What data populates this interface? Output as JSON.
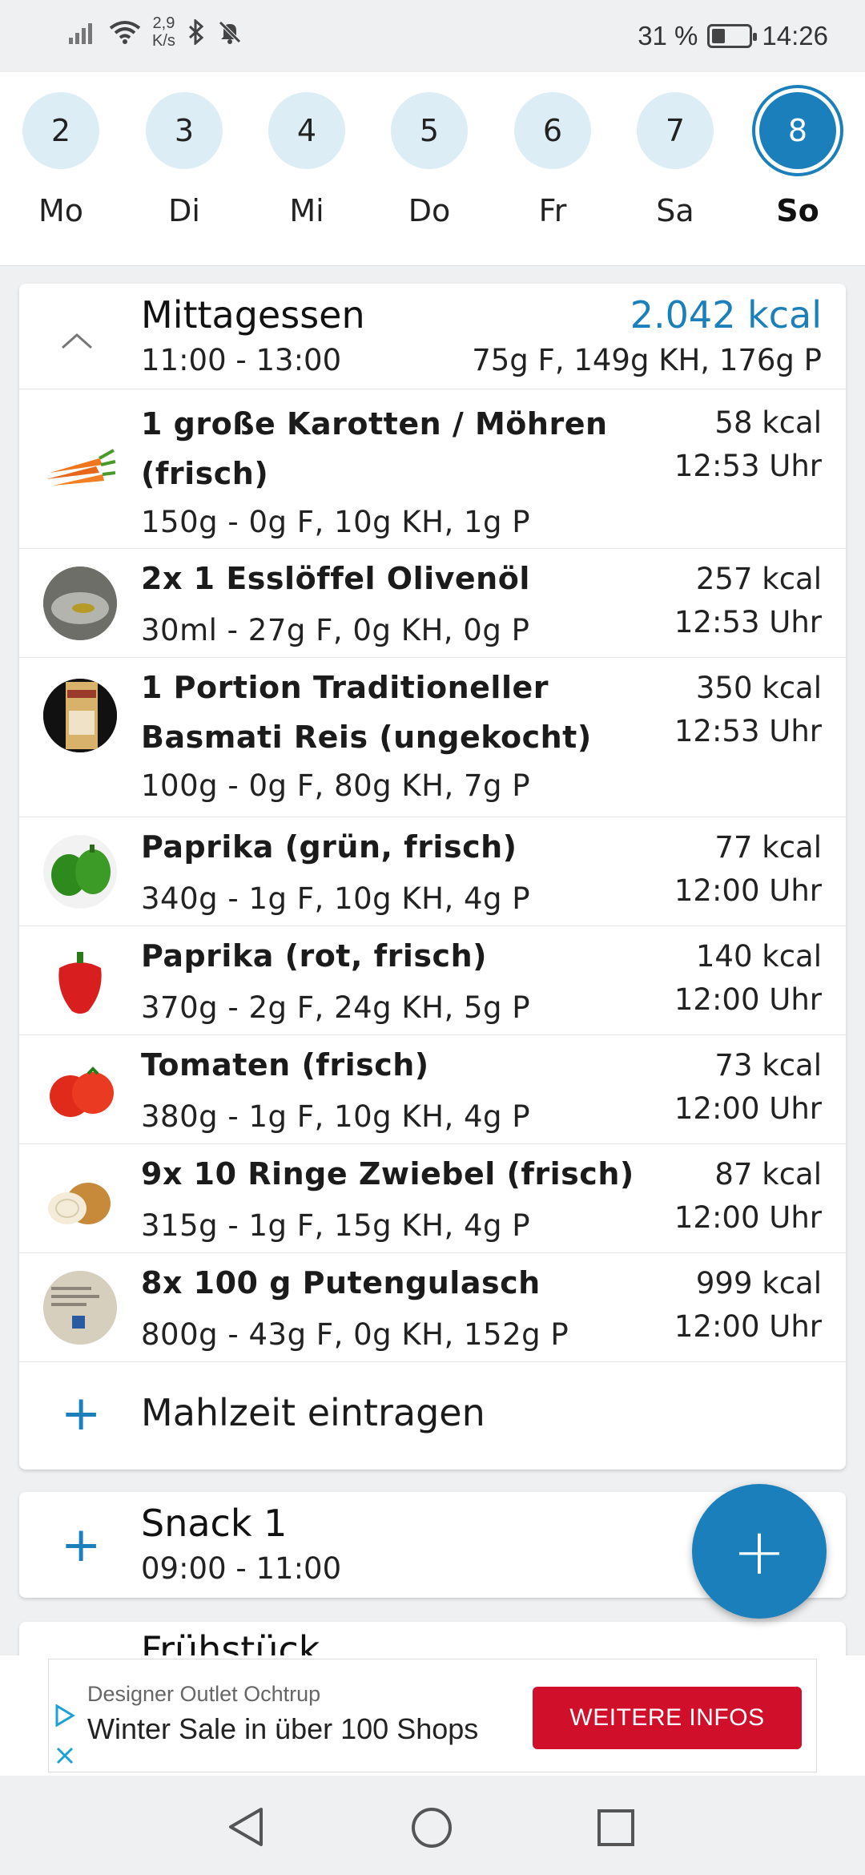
{
  "status": {
    "net_speed_value": "2,9",
    "net_speed_unit": "K/s",
    "battery": "31 %",
    "time": "14:26"
  },
  "week": {
    "days": [
      {
        "num": "2",
        "label": "Mo"
      },
      {
        "num": "3",
        "label": "Di"
      },
      {
        "num": "4",
        "label": "Mi"
      },
      {
        "num": "5",
        "label": "Do"
      },
      {
        "num": "6",
        "label": "Fr"
      },
      {
        "num": "7",
        "label": "Sa"
      },
      {
        "num": "8",
        "label": "So"
      }
    ],
    "selected_index": 6
  },
  "lunch": {
    "title": "Mittagessen",
    "time": "11:00 - 13:00",
    "kcal": "2.042 kcal",
    "macros": "75g F, 149g KH, 176g P",
    "items": [
      {
        "name_line1": "1 große Karotten / Möhren",
        "name_line2": "(frisch)",
        "details": "150g - 0g F, 10g KH, 1g P",
        "kcal": "58 kcal",
        "time": "12:53 Uhr",
        "image": "carrot"
      },
      {
        "name_line1": "2x 1 Esslöffel Olivenöl",
        "name_line2": "",
        "details": "30ml - 27g F, 0g KH, 0g P",
        "kcal": "257 kcal",
        "time": "12:53 Uhr",
        "image": "olive-oil"
      },
      {
        "name_line1": "1 Portion Traditioneller",
        "name_line2": "Basmati Reis (ungekocht)",
        "details": "100g - 0g F, 80g KH, 7g P",
        "kcal": "350 kcal",
        "time": "12:53 Uhr",
        "image": "basmati-rice"
      },
      {
        "name_line1": "Paprika (grün, frisch)",
        "name_line2": "",
        "details": "340g - 1g F, 10g KH, 4g P",
        "kcal": "77 kcal",
        "time": "12:00 Uhr",
        "image": "green-pepper"
      },
      {
        "name_line1": "Paprika (rot, frisch)",
        "name_line2": "",
        "details": "370g - 2g F, 24g KH, 5g P",
        "kcal": "140 kcal",
        "time": "12:00 Uhr",
        "image": "red-pepper"
      },
      {
        "name_line1": "Tomaten (frisch)",
        "name_line2": "",
        "details": "380g - 1g F, 10g KH, 4g P",
        "kcal": "73 kcal",
        "time": "12:00 Uhr",
        "image": "tomato"
      },
      {
        "name_line1": "9x 10 Ringe Zwiebel (frisch)",
        "name_line2": "",
        "details": "315g - 1g F, 15g KH, 4g P",
        "kcal": "87 kcal",
        "time": "12:00 Uhr",
        "image": "onion"
      },
      {
        "name_line1": "8x 100 g Putengulasch",
        "name_line2": "",
        "details": "800g - 43g F, 0g KH, 152g P",
        "kcal": "999 kcal",
        "time": "12:00 Uhr",
        "image": "turkey-package"
      }
    ],
    "add_label": "Mahlzeit eintragen"
  },
  "snack": {
    "title": "Snack 1",
    "time": "09:00 - 11:00"
  },
  "breakfast": {
    "title": "Frühstück"
  },
  "fab_label": "+",
  "ad": {
    "advertiser": "Designer Outlet Ochtrup",
    "headline": "Winter Sale in über 100 Shops",
    "cta": "WEITERE INFOS"
  },
  "colors": {
    "accent": "#1a7fba",
    "day_bg": "#dcedf5",
    "ad_button": "#d0102b"
  }
}
